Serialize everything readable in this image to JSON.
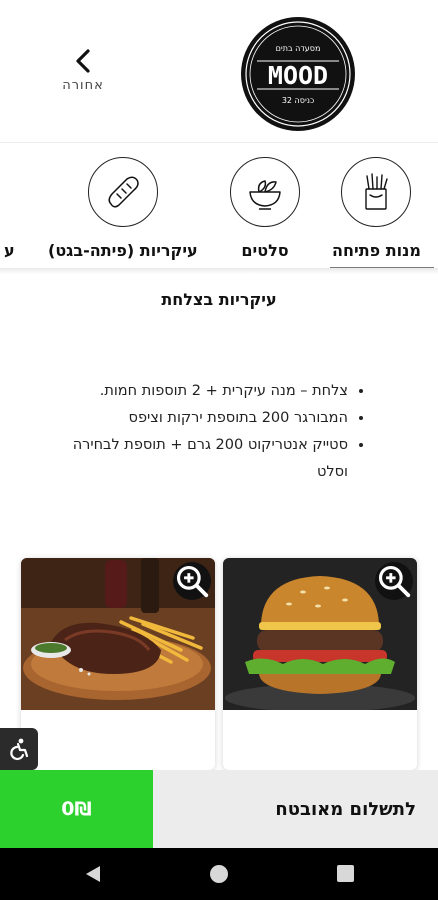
{
  "header": {
    "back_label": "אחורה",
    "logo_text": "MOOD",
    "logo_top_text": "מסעדה בתים",
    "logo_bottom_text": "כניסה 32"
  },
  "categories": [
    {
      "label": "מנות פתיחה",
      "icon": "fries-icon"
    },
    {
      "label": "סלטים",
      "icon": "salad-bowl-icon"
    },
    {
      "label": "עיקריות (פיתה-בגט)",
      "icon": "bread-icon"
    },
    {
      "label": "ע",
      "icon": ""
    }
  ],
  "section": {
    "title": "עיקריות בצלחת",
    "bullets": [
      "צלחת – מנה עיקרית + 2 תוספות חמות.",
      "המבורגר 200 בתוספת ירקות וציפס",
      "סטייק אנטריקוט 200 גרם + תוספת לבחירה וסלט"
    ]
  },
  "products": [
    {
      "name": "burger-card",
      "image": "burger"
    },
    {
      "name": "steak-card",
      "image": "steak"
    }
  ],
  "pay": {
    "label": "לתשלום מאובטח",
    "total": "0₪",
    "accent": "#2dd12d"
  }
}
